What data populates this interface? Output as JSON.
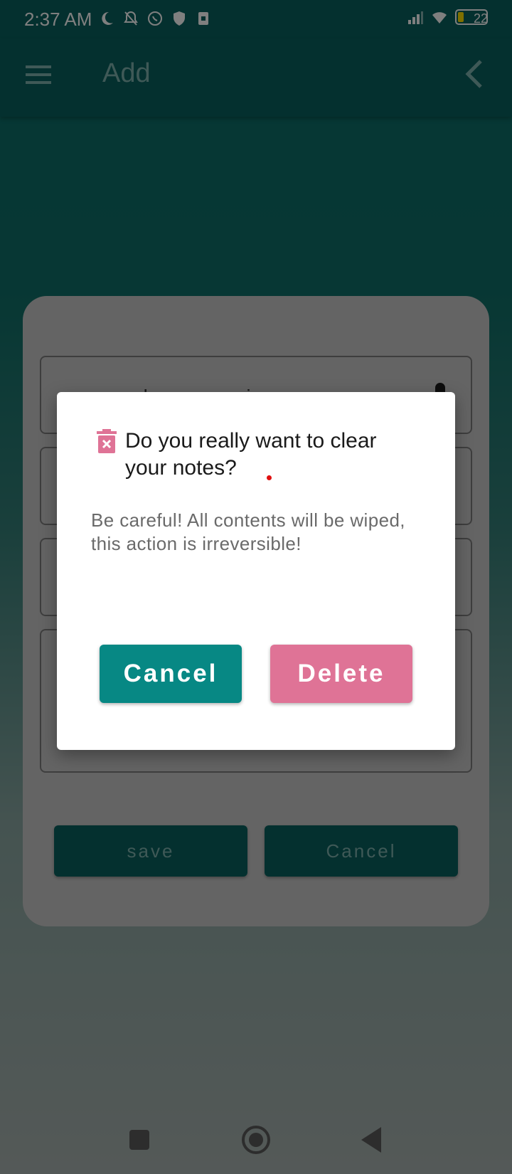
{
  "status_bar": {
    "time": "2:37 AM",
    "battery_level": "22",
    "icons": [
      "moon-icon",
      "bell-off-icon",
      "viber-icon",
      "shield-icon",
      "sim-icon",
      "signal-icon",
      "wifi-icon",
      "battery-icon"
    ]
  },
  "app_bar": {
    "title": "Add",
    "icons": [
      "menu-icon",
      "back-chevron-icon"
    ]
  },
  "form": {
    "field1_placeholder": "new word or expression",
    "save_label": "save",
    "cancel_label": "Cancel"
  },
  "dialog": {
    "title": "Do you really want to clear your notes?",
    "message": "Be careful! All contents will be wiped, this action is irreversible!",
    "cancel_label": "Cancel",
    "delete_label": "Delete",
    "icon": "trash-x-icon"
  },
  "nav_bar": {
    "icons": [
      "recents-square-icon",
      "home-circle-icon",
      "back-triangle-icon"
    ]
  },
  "colors": {
    "primary": "#08615e",
    "dialog_cancel": "#078884",
    "dialog_delete": "#df7396"
  }
}
